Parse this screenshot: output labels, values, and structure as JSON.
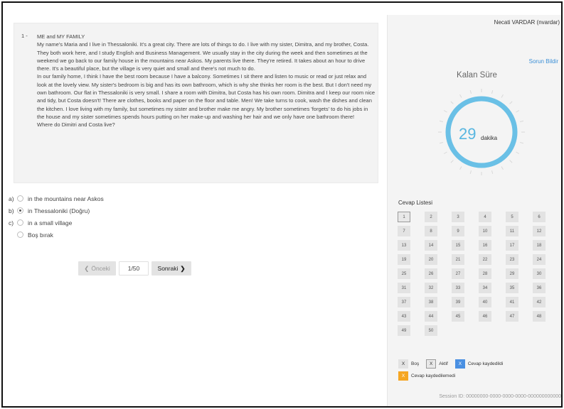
{
  "user": {
    "name": "Necati VARDAR (nvardar)"
  },
  "report_link": "Sorun Bildir",
  "timer": {
    "title": "Kalan Süre",
    "value": "29",
    "unit": "dakika",
    "accent": "#6ac0e6"
  },
  "question": {
    "number": "1 -",
    "paragraphs": [
      "ME and MY FAMILY",
      "My name's Maria and I live in Thessaloniki. It's a great city. There are lots of things to do. I live with my sister, Dimitra, and my brother, Costa. They both work here, and I study English and Business Management. We usually stay in the city during the week and then sometimes at the weekend we go back to our family house in the mountains near Askos. My parents live there. They're retired. It takes about an hour to drive there. It's a beautiful place, but the village is very quiet and small and there's not much to do.",
      "In our family home, I think I have the best room because I have a balcony. Sometimes I sit there and listen to music or read or just relax and look at the lovely view. My sister's bedroom is big and has its own bathroom, which is why she thinks her room is the best. But I don't need my own bathroom. Our flat in Thessaloniki is very small. I share a room with Dimitra, but Costa has his own room. Dimitra and I keep our room nice and tidy, but Costa doesn't! There are clothes, books and paper on the floor and table. Men! We take turns to cook, wash the dishes and clean the kitchen. I love living with my family, but sometimes my sister and brother make me angry. My brother sometimes 'forgets' to do his jobs in the house and my sister sometimes spends hours putting on her make-up and washing her hair and we only have one bathroom there!",
      "Where do Dimitri and Costa live?"
    ]
  },
  "answers": [
    {
      "letter": "a)",
      "text": "in the mountains near Askos",
      "checked": false
    },
    {
      "letter": "b)",
      "text": "in Thessaloniki (Doğru)",
      "checked": true
    },
    {
      "letter": "c)",
      "text": "in a small village",
      "checked": false
    },
    {
      "letter": "",
      "text": "Boş bırak",
      "checked": false
    }
  ],
  "pager": {
    "prev": "Önceki",
    "page": "1/50",
    "next": "Sonraki"
  },
  "answer_list": {
    "title": "Cevap Listesi",
    "items": [
      "1",
      "2",
      "3",
      "4",
      "5",
      "6",
      "7",
      "8",
      "9",
      "10",
      "11",
      "12",
      "13",
      "14",
      "15",
      "16",
      "17",
      "18",
      "19",
      "20",
      "21",
      "22",
      "23",
      "24",
      "25",
      "26",
      "27",
      "28",
      "29",
      "30",
      "31",
      "32",
      "33",
      "34",
      "35",
      "36",
      "37",
      "38",
      "39",
      "40",
      "41",
      "42",
      "43",
      "44",
      "45",
      "46",
      "47",
      "48",
      "49",
      "50"
    ],
    "active_index": 0
  },
  "legend": {
    "empty": {
      "mark": "X",
      "label": "Boş"
    },
    "active": {
      "mark": "X",
      "label": "Aktif"
    },
    "saved": {
      "mark": "X",
      "label": "Cevap kaydedildi",
      "color": "#4a90e2"
    },
    "unsaved": {
      "mark": "X",
      "label": "Cevap kaydedilemedi",
      "color": "#f5a623"
    }
  },
  "session": "Session ID: 00000000-0000-0000-0000-000000000000"
}
